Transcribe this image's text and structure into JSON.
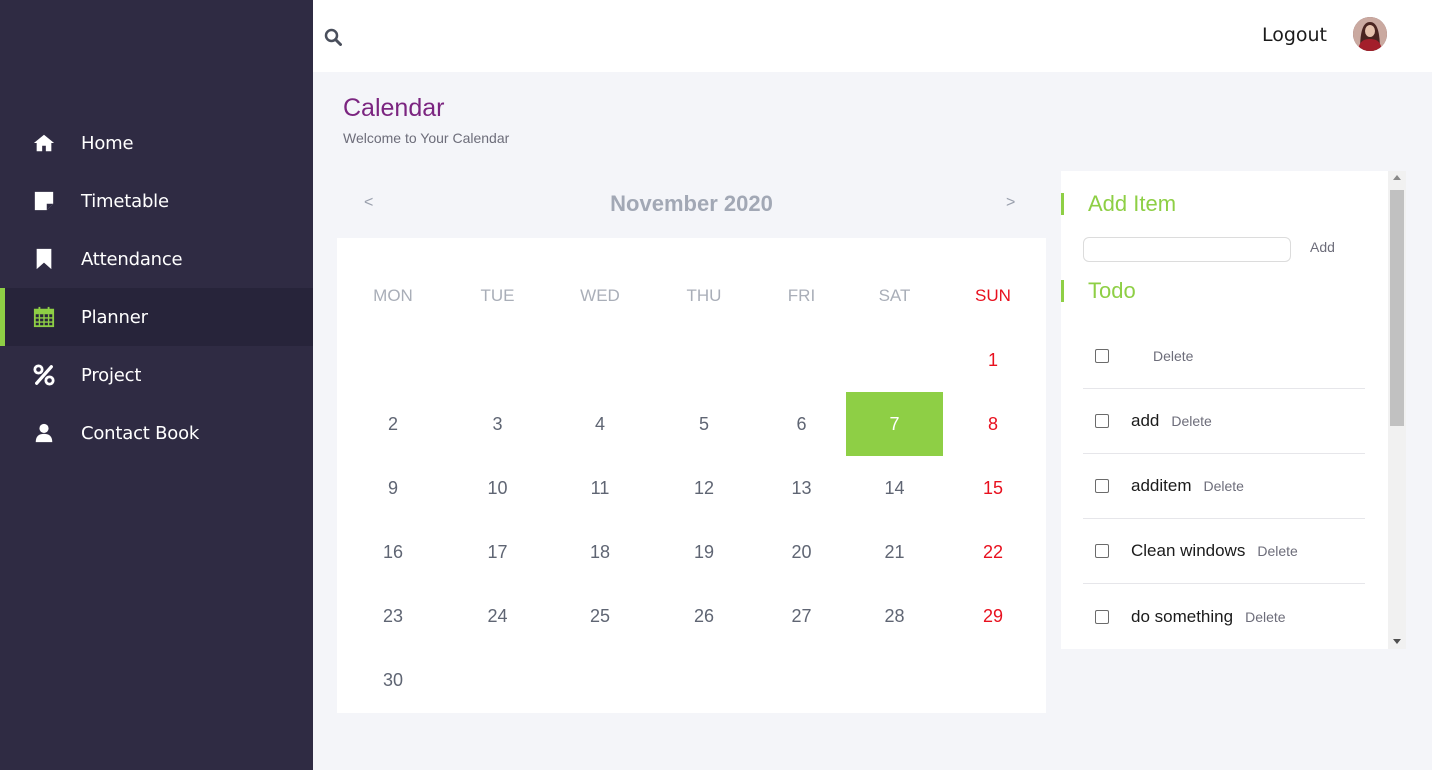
{
  "sidebar": {
    "items": [
      {
        "label": "Home",
        "icon": "home-icon"
      },
      {
        "label": "Timetable",
        "icon": "note-icon"
      },
      {
        "label": "Attendance",
        "icon": "bookmark-icon"
      },
      {
        "label": "Planner",
        "icon": "calendar-icon",
        "active": true
      },
      {
        "label": "Project",
        "icon": "percent-icon"
      },
      {
        "label": "Contact Book",
        "icon": "user-icon"
      }
    ]
  },
  "topbar": {
    "logout_label": "Logout",
    "search_icon": "search-icon",
    "avatar": "avatar"
  },
  "page": {
    "title": "Calendar",
    "subtitle": "Welcome to Your Calendar"
  },
  "calendar": {
    "prev": "<",
    "next": ">",
    "month": "November 2020",
    "weekdays": [
      "MON",
      "TUE",
      "WED",
      "THU",
      "FRI",
      "SAT",
      "SUN"
    ],
    "weeks": [
      [
        "",
        "",
        "",
        "",
        "",
        "",
        "1"
      ],
      [
        "2",
        "3",
        "4",
        "5",
        "6",
        "7",
        "8"
      ],
      [
        "9",
        "10",
        "11",
        "12",
        "13",
        "14",
        "15"
      ],
      [
        "16",
        "17",
        "18",
        "19",
        "20",
        "21",
        "22"
      ],
      [
        "23",
        "24",
        "25",
        "26",
        "27",
        "28",
        "29"
      ],
      [
        "30",
        "",
        "",
        "",
        "",
        "",
        ""
      ]
    ],
    "today": "7"
  },
  "panel": {
    "add_title": "Add Item",
    "add_button": "Add",
    "input_value": "",
    "todo_title": "Todo",
    "delete_label": "Delete",
    "todos": [
      "",
      "add",
      "additem",
      "Clean windows",
      "do something"
    ]
  },
  "colors": {
    "accent": "#8ecf45",
    "sidebar": "#2f2b43",
    "title": "#7b2580",
    "sunday": "#e8101e"
  }
}
